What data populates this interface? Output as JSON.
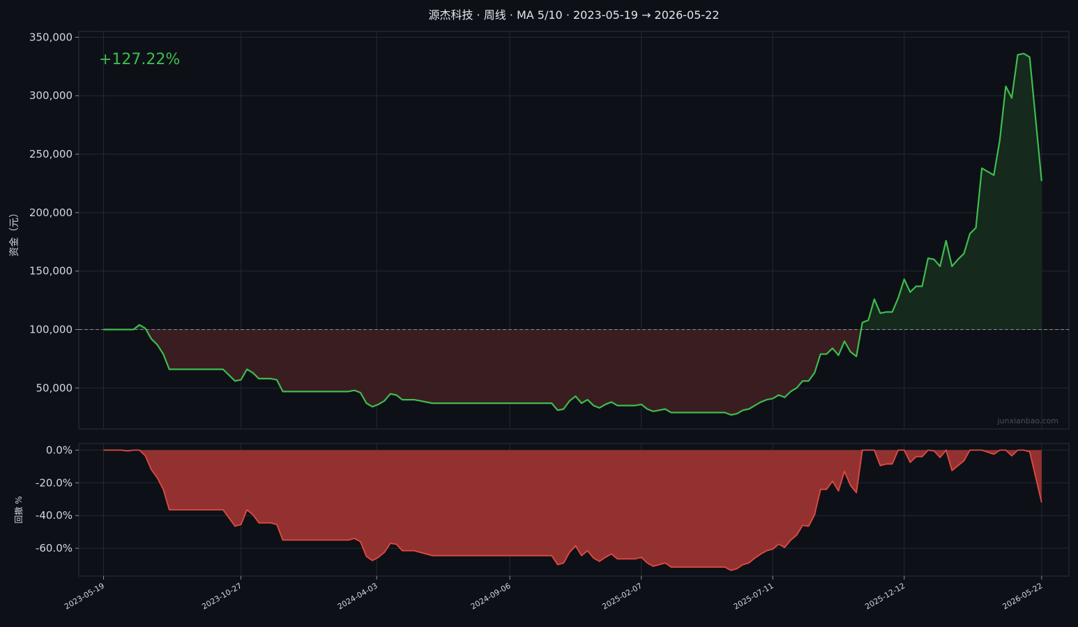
{
  "chart_data": [
    {
      "type": "area",
      "title": "源杰科技 · 周线 · MA 5/10 · 2023-05-19 → 2026-05-22",
      "ylabel": "资金（元）",
      "annotation": "+127.22%",
      "watermark": "junxianbao.com",
      "baseline": 100000,
      "ylim": [
        15000,
        355000
      ],
      "yticks": [
        50000,
        100000,
        150000,
        200000,
        250000,
        300000,
        350000
      ],
      "ytick_labels": [
        "50,000",
        "100,000",
        "150,000",
        "200,000",
        "250,000",
        "300,000",
        "350,000"
      ],
      "xlim": [
        "2023-04-20",
        "2026-06-23"
      ],
      "xticks": [
        "2023-05-19",
        "2023-10-27",
        "2024-04-03",
        "2024-09-06",
        "2025-02-07",
        "2025-07-11",
        "2025-12-12",
        "2026-05-22"
      ],
      "grid": true,
      "colors": {
        "line": "#3fbd4e",
        "gain_fill": "#15291c",
        "loss_fill": "#3a1d21",
        "baseline": "#8a8f98",
        "annotation": "#3fbd4e"
      },
      "series": [
        {
          "values": [
            [
              "2023-05-19",
              100000
            ],
            [
              "2023-06-09",
              100000
            ],
            [
              "2023-06-23",
              100000
            ],
            [
              "2023-06-30",
              104000
            ],
            [
              "2023-07-07",
              101000
            ],
            [
              "2023-07-14",
              92000
            ],
            [
              "2023-07-21",
              87000
            ],
            [
              "2023-07-28",
              79000
            ],
            [
              "2023-08-04",
              66000
            ],
            [
              "2023-10-06",
              66000
            ],
            [
              "2023-10-20",
              56000
            ],
            [
              "2023-10-27",
              57000
            ],
            [
              "2023-11-03",
              66000
            ],
            [
              "2023-11-10",
              63000
            ],
            [
              "2023-11-17",
              58000
            ],
            [
              "2023-12-01",
              58000
            ],
            [
              "2023-12-08",
              57000
            ],
            [
              "2023-12-15",
              47000
            ],
            [
              "2024-03-01",
              47000
            ],
            [
              "2024-03-08",
              48000
            ],
            [
              "2024-03-15",
              46000
            ],
            [
              "2024-03-22",
              37000
            ],
            [
              "2024-03-29",
              34000
            ],
            [
              "2024-04-05",
              36000
            ],
            [
              "2024-04-12",
              39000
            ],
            [
              "2024-04-19",
              45000
            ],
            [
              "2024-04-26",
              44000
            ],
            [
              "2024-05-03",
              40000
            ],
            [
              "2024-05-17",
              40000
            ],
            [
              "2024-06-07",
              37000
            ],
            [
              "2024-10-25",
              37000
            ],
            [
              "2024-11-01",
              31000
            ],
            [
              "2024-11-08",
              32000
            ],
            [
              "2024-11-15",
              39000
            ],
            [
              "2024-11-22",
              43000
            ],
            [
              "2024-11-29",
              37000
            ],
            [
              "2024-12-06",
              40000
            ],
            [
              "2024-12-13",
              35000
            ],
            [
              "2024-12-20",
              33000
            ],
            [
              "2024-12-27",
              36000
            ],
            [
              "2025-01-03",
              38000
            ],
            [
              "2025-01-10",
              35000
            ],
            [
              "2025-01-31",
              35000
            ],
            [
              "2025-02-07",
              36000
            ],
            [
              "2025-02-14",
              32000
            ],
            [
              "2025-02-21",
              30000
            ],
            [
              "2025-02-28",
              31000
            ],
            [
              "2025-03-07",
              32000
            ],
            [
              "2025-03-14",
              29000
            ],
            [
              "2025-05-16",
              29000
            ],
            [
              "2025-05-23",
              27000
            ],
            [
              "2025-05-30",
              28000
            ],
            [
              "2025-06-06",
              31000
            ],
            [
              "2025-06-13",
              32000
            ],
            [
              "2025-06-20",
              35000
            ],
            [
              "2025-06-27",
              38000
            ],
            [
              "2025-07-04",
              40000
            ],
            [
              "2025-07-11",
              41000
            ],
            [
              "2025-07-18",
              44000
            ],
            [
              "2025-07-25",
              42000
            ],
            [
              "2025-08-01",
              47000
            ],
            [
              "2025-08-08",
              50000
            ],
            [
              "2025-08-15",
              56000
            ],
            [
              "2025-08-22",
              56000
            ],
            [
              "2025-08-29",
              63000
            ],
            [
              "2025-09-05",
              79000
            ],
            [
              "2025-09-12",
              79000
            ],
            [
              "2025-09-19",
              84000
            ],
            [
              "2025-09-26",
              78000
            ],
            [
              "2025-10-03",
              90000
            ],
            [
              "2025-10-10",
              81000
            ],
            [
              "2025-10-17",
              77000
            ],
            [
              "2025-10-24",
              106000
            ],
            [
              "2025-10-31",
              108000
            ],
            [
              "2025-11-07",
              126000
            ],
            [
              "2025-11-14",
              114000
            ],
            [
              "2025-11-21",
              115000
            ],
            [
              "2025-11-28",
              115000
            ],
            [
              "2025-12-05",
              127000
            ],
            [
              "2025-12-12",
              143000
            ],
            [
              "2025-12-19",
              132000
            ],
            [
              "2025-12-26",
              137000
            ],
            [
              "2026-01-02",
              137000
            ],
            [
              "2026-01-09",
              161000
            ],
            [
              "2026-01-16",
              160000
            ],
            [
              "2026-01-23",
              154000
            ],
            [
              "2026-01-30",
              176000
            ],
            [
              "2026-02-06",
              154000
            ],
            [
              "2026-02-13",
              160000
            ],
            [
              "2026-02-20",
              165000
            ],
            [
              "2026-02-27",
              182000
            ],
            [
              "2026-03-06",
              187000
            ],
            [
              "2026-03-13",
              238000
            ],
            [
              "2026-03-27",
              232000
            ],
            [
              "2026-04-03",
              262000
            ],
            [
              "2026-04-10",
              308000
            ],
            [
              "2026-04-17",
              298000
            ],
            [
              "2026-04-24",
              335000
            ],
            [
              "2026-05-01",
              336000
            ],
            [
              "2026-05-08",
              333000
            ],
            [
              "2026-05-22",
              227000
            ]
          ]
        }
      ]
    },
    {
      "type": "area",
      "ylabel": "回撤 %",
      "ylim": [
        -77,
        4
      ],
      "yticks": [
        0,
        -20,
        -40,
        -60
      ],
      "ytick_labels": [
        "0.0%",
        "-20.0%",
        "-40.0%",
        "-60.0%"
      ],
      "grid": true,
      "colors": {
        "line": "#e04b43",
        "fill": "#933130"
      },
      "series": [
        {
          "values": [
            [
              "2023-05-19",
              0
            ],
            [
              "2023-06-09",
              0
            ],
            [
              "2023-06-16",
              -0.5
            ],
            [
              "2023-06-23",
              0
            ],
            [
              "2023-06-30",
              0
            ],
            [
              "2023-07-07",
              -3.5
            ],
            [
              "2023-07-14",
              -12
            ],
            [
              "2023-07-21",
              -17
            ],
            [
              "2023-07-28",
              -24
            ],
            [
              "2023-08-04",
              -36.5
            ],
            [
              "2023-10-06",
              -36.5
            ],
            [
              "2023-10-20",
              -46.5
            ],
            [
              "2023-10-27",
              -45.5
            ],
            [
              "2023-11-03",
              -36.5
            ],
            [
              "2023-11-10",
              -39.5
            ],
            [
              "2023-11-17",
              -44.5
            ],
            [
              "2023-12-01",
              -44.5
            ],
            [
              "2023-12-08",
              -45.5
            ],
            [
              "2023-12-15",
              -55
            ],
            [
              "2024-03-01",
              -55
            ],
            [
              "2024-03-08",
              -54
            ],
            [
              "2024-03-15",
              -56
            ],
            [
              "2024-03-22",
              -65
            ],
            [
              "2024-03-29",
              -67.5
            ],
            [
              "2024-04-05",
              -65.5
            ],
            [
              "2024-04-12",
              -62.5
            ],
            [
              "2024-04-19",
              -57
            ],
            [
              "2024-04-26",
              -57.5
            ],
            [
              "2024-05-03",
              -61.5
            ],
            [
              "2024-05-17",
              -61.5
            ],
            [
              "2024-06-07",
              -64.5
            ],
            [
              "2024-10-25",
              -64.5
            ],
            [
              "2024-11-01",
              -70
            ],
            [
              "2024-11-08",
              -69
            ],
            [
              "2024-11-15",
              -62.5
            ],
            [
              "2024-11-22",
              -58.5
            ],
            [
              "2024-11-29",
              -64.5
            ],
            [
              "2024-12-06",
              -61.5
            ],
            [
              "2024-12-13",
              -66
            ],
            [
              "2024-12-20",
              -68
            ],
            [
              "2024-12-27",
              -65.5
            ],
            [
              "2025-01-03",
              -63.5
            ],
            [
              "2025-01-10",
              -66.5
            ],
            [
              "2025-01-31",
              -66.5
            ],
            [
              "2025-02-07",
              -65.5
            ],
            [
              "2025-02-14",
              -69
            ],
            [
              "2025-02-21",
              -71
            ],
            [
              "2025-02-28",
              -70
            ],
            [
              "2025-03-07",
              -69
            ],
            [
              "2025-03-14",
              -71.5
            ],
            [
              "2025-05-16",
              -71.5
            ],
            [
              "2025-05-23",
              -73.5
            ],
            [
              "2025-05-30",
              -72.5
            ],
            [
              "2025-06-06",
              -70
            ],
            [
              "2025-06-13",
              -69
            ],
            [
              "2025-06-20",
              -66
            ],
            [
              "2025-06-27",
              -63.5
            ],
            [
              "2025-07-04",
              -61.5
            ],
            [
              "2025-07-11",
              -60.5
            ],
            [
              "2025-07-18",
              -57.5
            ],
            [
              "2025-07-25",
              -59.5
            ],
            [
              "2025-08-01",
              -55
            ],
            [
              "2025-08-08",
              -52
            ],
            [
              "2025-08-15",
              -46
            ],
            [
              "2025-08-22",
              -46.5
            ],
            [
              "2025-08-29",
              -39.5
            ],
            [
              "2025-09-05",
              -24
            ],
            [
              "2025-09-12",
              -24
            ],
            [
              "2025-09-19",
              -19
            ],
            [
              "2025-09-26",
              -25
            ],
            [
              "2025-10-03",
              -13
            ],
            [
              "2025-10-10",
              -21.5
            ],
            [
              "2025-10-17",
              -26
            ],
            [
              "2025-10-24",
              0
            ],
            [
              "2025-11-07",
              0
            ],
            [
              "2025-11-14",
              -9.5
            ],
            [
              "2025-11-21",
              -8.5
            ],
            [
              "2025-11-28",
              -8.5
            ],
            [
              "2025-12-05",
              0
            ],
            [
              "2025-12-12",
              0
            ],
            [
              "2025-12-19",
              -7.5
            ],
            [
              "2025-12-26",
              -4
            ],
            [
              "2026-01-02",
              -4
            ],
            [
              "2026-01-09",
              0
            ],
            [
              "2026-01-16",
              -0.5
            ],
            [
              "2026-01-23",
              -4.5
            ],
            [
              "2026-01-30",
              0
            ],
            [
              "2026-02-06",
              -12.5
            ],
            [
              "2026-02-13",
              -9.5
            ],
            [
              "2026-02-20",
              -6.5
            ],
            [
              "2026-02-27",
              0
            ],
            [
              "2026-03-13",
              0
            ],
            [
              "2026-03-27",
              -2.5
            ],
            [
              "2026-04-03",
              0
            ],
            [
              "2026-04-10",
              0
            ],
            [
              "2026-04-17",
              -3.5
            ],
            [
              "2026-04-24",
              0
            ],
            [
              "2026-05-01",
              0
            ],
            [
              "2026-05-08",
              -1
            ],
            [
              "2026-05-22",
              -32
            ]
          ]
        }
      ]
    }
  ]
}
